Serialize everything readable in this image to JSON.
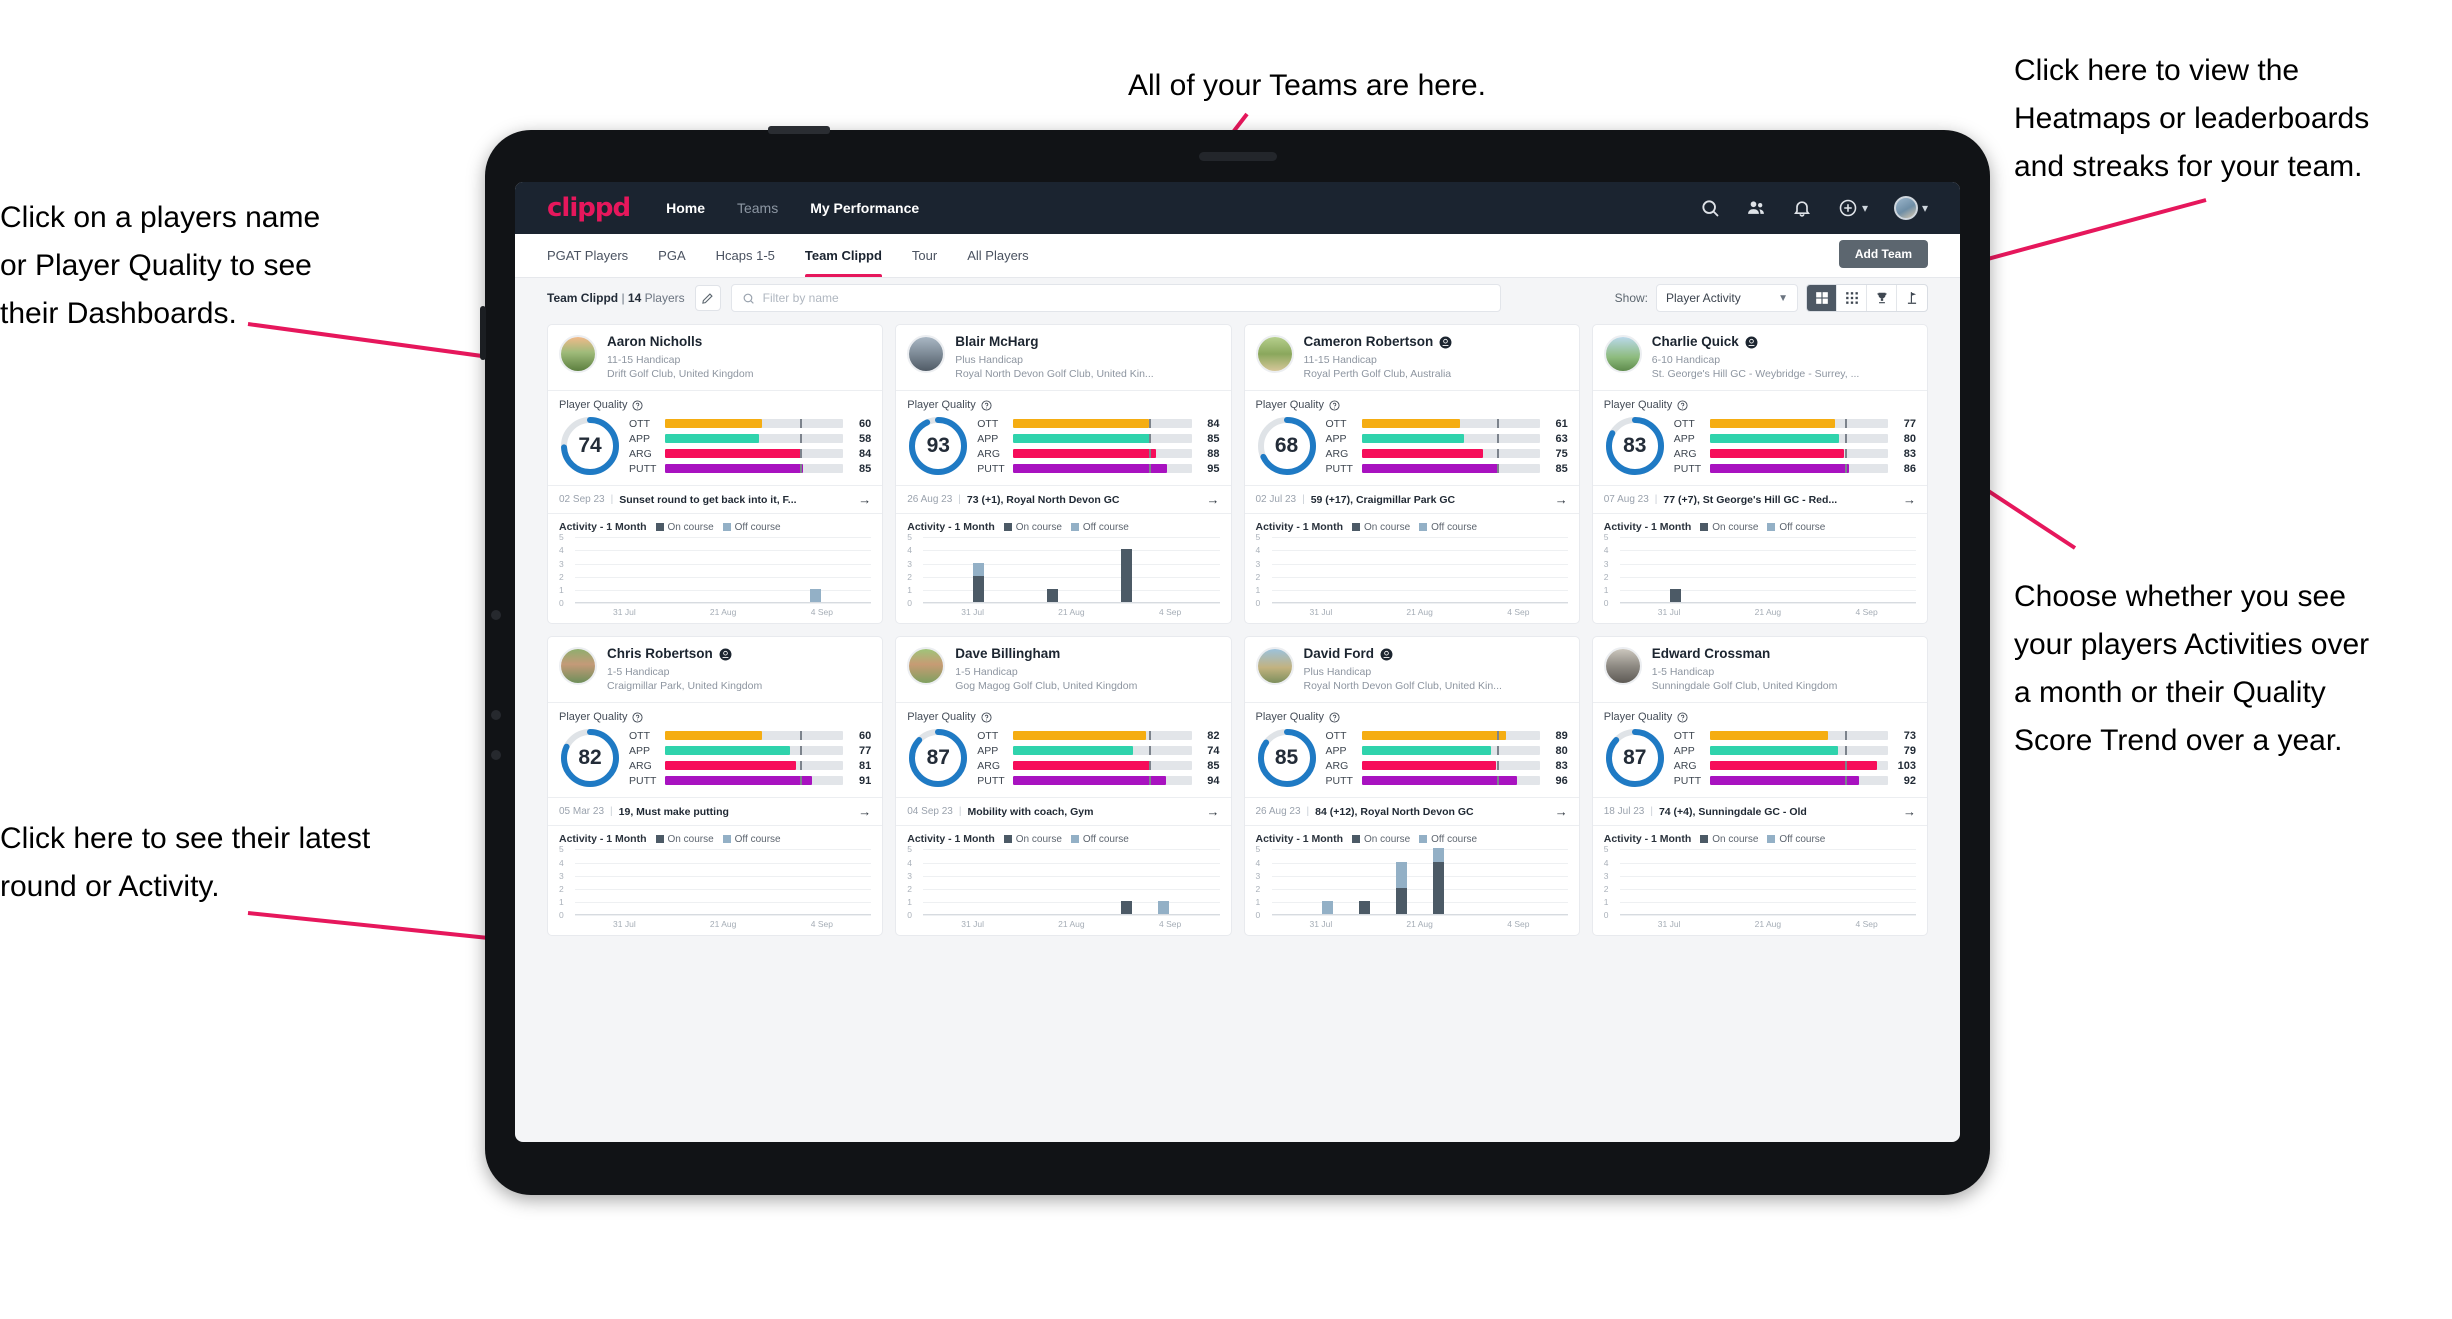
{
  "annotations": [
    {
      "id": "a-players-name",
      "text": "Click on a players name\nor Player Quality to see\ntheir Dashboards."
    },
    {
      "id": "a-teams",
      "text": "All of your Teams are here."
    },
    {
      "id": "a-heatmaps",
      "text": "Click here to view the\nHeatmaps or leaderboards\nand streaks for your team."
    },
    {
      "id": "a-choose",
      "text": "Choose whether you see\nyour players Activities over\na month or their Quality\nScore Trend over a year."
    },
    {
      "id": "a-latest",
      "text": "Click here to see their latest\nround or Activity."
    }
  ],
  "colors": {
    "accent": "#e6175c",
    "topnav_bg": "#1b2430",
    "ring": "#1f7ac4",
    "ott": "#f5ad12",
    "app": "#2fd3ac",
    "arg": "#f60d5a",
    "putt": "#a812c0",
    "on_course": "#4c5a66",
    "off_course": "#93b0c6"
  },
  "topnav": {
    "logo": "clippd",
    "links": [
      {
        "label": "Home",
        "active": true
      },
      {
        "label": "Teams",
        "active": false
      },
      {
        "label": "My Performance",
        "active": true
      }
    ],
    "icons": [
      "search-icon",
      "people-icon",
      "bell-icon",
      "plus-circle-icon",
      "avatar"
    ]
  },
  "subnav": {
    "tabs": [
      {
        "label": "PGAT Players",
        "active": false
      },
      {
        "label": "PGA",
        "active": false
      },
      {
        "label": "Hcaps 1-5",
        "active": false
      },
      {
        "label": "Team Clippd",
        "active": true
      },
      {
        "label": "Tour",
        "active": false
      },
      {
        "label": "All Players",
        "active": false
      }
    ],
    "add_team_label": "Add Team"
  },
  "filterbar": {
    "team_name": "Team Clippd",
    "team_count": "14",
    "players_word": "Players",
    "edit_icon": "pencil-icon",
    "search_placeholder": "Filter by name",
    "search_value": "",
    "show_label": "Show:",
    "show_value": "Player Activity",
    "show_options": [
      "Player Activity",
      "Quality Score Trend"
    ],
    "view_buttons": [
      "grid-large-icon",
      "grid-small-icon",
      "trophy-icon",
      "flag-icon"
    ],
    "active_view": 0
  },
  "card_labels": {
    "player_quality": "Player Quality",
    "activity_title": "Activity - 1 Month",
    "legend_on": "On course",
    "legend_off": "Off course",
    "metric_names": [
      "OTT",
      "APP",
      "ARG",
      "PUTT"
    ],
    "x_ticks": [
      "31 Jul",
      "21 Aug",
      "4 Sep"
    ],
    "y_ticks": [
      "5",
      "4",
      "3",
      "2",
      "1",
      "0"
    ],
    "arrow": "→"
  },
  "players": [
    {
      "name": "Aaron Nicholls",
      "verified": false,
      "handicap": "11-15 Handicap",
      "club": "Drift Golf Club, United Kingdom",
      "quality": 74,
      "metrics": [
        60,
        58,
        84,
        85
      ],
      "latest_date": "02 Sep 23",
      "latest_desc": "Sunset round to get back into it, F...",
      "chart_data": {
        "type": "bar",
        "title": "Activity - 1 Month",
        "categories": [
          "31 Jul",
          "",
          "",
          "",
          "21 Aug",
          "",
          "4 Sep",
          ""
        ],
        "series": [
          {
            "name": "On course",
            "values": [
              0,
              0,
              0,
              0,
              0,
              0,
              0,
              0
            ]
          },
          {
            "name": "Off course",
            "values": [
              0,
              0,
              0,
              0,
              0,
              0,
              1,
              0
            ]
          }
        ],
        "ylim": [
          0,
          5
        ]
      }
    },
    {
      "name": "Blair McHarg",
      "verified": false,
      "handicap": "Plus Handicap",
      "club": "Royal North Devon Golf Club, United Kin...",
      "quality": 93,
      "metrics": [
        84,
        85,
        88,
        95
      ],
      "latest_date": "26 Aug 23",
      "latest_desc": "73 (+1), Royal North Devon GC",
      "chart_data": {
        "type": "bar",
        "title": "Activity - 1 Month",
        "categories": [
          "31 Jul",
          "",
          "",
          "",
          "21 Aug",
          "",
          "4 Sep",
          ""
        ],
        "series": [
          {
            "name": "On course",
            "values": [
              0,
              2,
              0,
              1,
              0,
              4,
              0,
              0
            ]
          },
          {
            "name": "Off course",
            "values": [
              0,
              1,
              0,
              0,
              0,
              0,
              0,
              0
            ]
          }
        ],
        "ylim": [
          0,
          5
        ]
      }
    },
    {
      "name": "Cameron Robertson",
      "verified": true,
      "handicap": "11-15 Handicap",
      "club": "Royal Perth Golf Club, Australia",
      "quality": 68,
      "metrics": [
        61,
        63,
        75,
        85
      ],
      "latest_date": "02 Jul 23",
      "latest_desc": "59 (+17), Craigmillar Park GC",
      "chart_data": {
        "type": "bar",
        "title": "Activity - 1 Month",
        "categories": [
          "31 Jul",
          "",
          "",
          "",
          "21 Aug",
          "",
          "4 Sep",
          ""
        ],
        "series": [
          {
            "name": "On course",
            "values": [
              0,
              0,
              0,
              0,
              0,
              0,
              0,
              0
            ]
          },
          {
            "name": "Off course",
            "values": [
              0,
              0,
              0,
              0,
              0,
              0,
              0,
              0
            ]
          }
        ],
        "ylim": [
          0,
          5
        ]
      }
    },
    {
      "name": "Charlie Quick",
      "verified": true,
      "handicap": "6-10 Handicap",
      "club": "St. George's Hill GC - Weybridge - Surrey, ...",
      "quality": 83,
      "metrics": [
        77,
        80,
        83,
        86
      ],
      "latest_date": "07 Aug 23",
      "latest_desc": "77 (+7), St George's Hill GC - Red...",
      "chart_data": {
        "type": "bar",
        "title": "Activity - 1 Month",
        "categories": [
          "31 Jul",
          "",
          "",
          "",
          "21 Aug",
          "",
          "4 Sep",
          ""
        ],
        "series": [
          {
            "name": "On course",
            "values": [
              0,
              1,
              0,
              0,
              0,
              0,
              0,
              0
            ]
          },
          {
            "name": "Off course",
            "values": [
              0,
              0,
              0,
              0,
              0,
              0,
              0,
              0
            ]
          }
        ],
        "ylim": [
          0,
          5
        ]
      }
    },
    {
      "name": "Chris Robertson",
      "verified": true,
      "handicap": "1-5 Handicap",
      "club": "Craigmillar Park, United Kingdom",
      "quality": 82,
      "metrics": [
        60,
        77,
        81,
        91
      ],
      "latest_date": "05 Mar 23",
      "latest_desc": "19, Must make putting",
      "chart_data": {
        "type": "bar",
        "title": "Activity - 1 Month",
        "categories": [
          "31 Jul",
          "",
          "",
          "",
          "21 Aug",
          "",
          "4 Sep",
          ""
        ],
        "series": [
          {
            "name": "On course",
            "values": [
              0,
              0,
              0,
              0,
              0,
              0,
              0,
              0
            ]
          },
          {
            "name": "Off course",
            "values": [
              0,
              0,
              0,
              0,
              0,
              0,
              0,
              0
            ]
          }
        ],
        "ylim": [
          0,
          5
        ]
      }
    },
    {
      "name": "Dave Billingham",
      "verified": false,
      "handicap": "1-5 Handicap",
      "club": "Gog Magog Golf Club, United Kingdom",
      "quality": 87,
      "metrics": [
        82,
        74,
        85,
        94
      ],
      "latest_date": "04 Sep 23",
      "latest_desc": "Mobility with coach, Gym",
      "chart_data": {
        "type": "bar",
        "title": "Activity - 1 Month",
        "categories": [
          "31 Jul",
          "",
          "",
          "",
          "21 Aug",
          "",
          "4 Sep",
          ""
        ],
        "series": [
          {
            "name": "On course",
            "values": [
              0,
              0,
              0,
              0,
              0,
              1,
              0,
              0
            ]
          },
          {
            "name": "Off course",
            "values": [
              0,
              0,
              0,
              0,
              0,
              0,
              1,
              0
            ]
          }
        ],
        "ylim": [
          0,
          5
        ]
      }
    },
    {
      "name": "David Ford",
      "verified": true,
      "handicap": "Plus Handicap",
      "club": "Royal North Devon Golf Club, United Kin...",
      "quality": 85,
      "metrics": [
        89,
        80,
        83,
        96
      ],
      "latest_date": "26 Aug 23",
      "latest_desc": "84 (+12), Royal North Devon GC",
      "chart_data": {
        "type": "bar",
        "title": "Activity - 1 Month",
        "categories": [
          "31 Jul",
          "",
          "",
          "",
          "21 Aug",
          "",
          "4 Sep",
          ""
        ],
        "series": [
          {
            "name": "On course",
            "values": [
              0,
              0,
              1,
              2,
              4,
              0,
              0,
              0
            ]
          },
          {
            "name": "Off course",
            "values": [
              0,
              1,
              0,
              2,
              1,
              0,
              0,
              0
            ]
          }
        ],
        "ylim": [
          0,
          5
        ]
      }
    },
    {
      "name": "Edward Crossman",
      "verified": false,
      "handicap": "1-5 Handicap",
      "club": "Sunningdale Golf Club, United Kingdom",
      "quality": 87,
      "metrics": [
        73,
        79,
        103,
        92
      ],
      "latest_date": "18 Jul 23",
      "latest_desc": "74 (+4), Sunningdale GC - Old",
      "chart_data": {
        "type": "bar",
        "title": "Activity - 1 Month",
        "categories": [
          "31 Jul",
          "",
          "",
          "",
          "21 Aug",
          "",
          "4 Sep",
          ""
        ],
        "series": [
          {
            "name": "On course",
            "values": [
              0,
              0,
              0,
              0,
              0,
              0,
              0,
              0
            ]
          },
          {
            "name": "Off course",
            "values": [
              0,
              0,
              0,
              0,
              0,
              0,
              0,
              0
            ]
          }
        ],
        "ylim": [
          0,
          5
        ]
      }
    }
  ]
}
